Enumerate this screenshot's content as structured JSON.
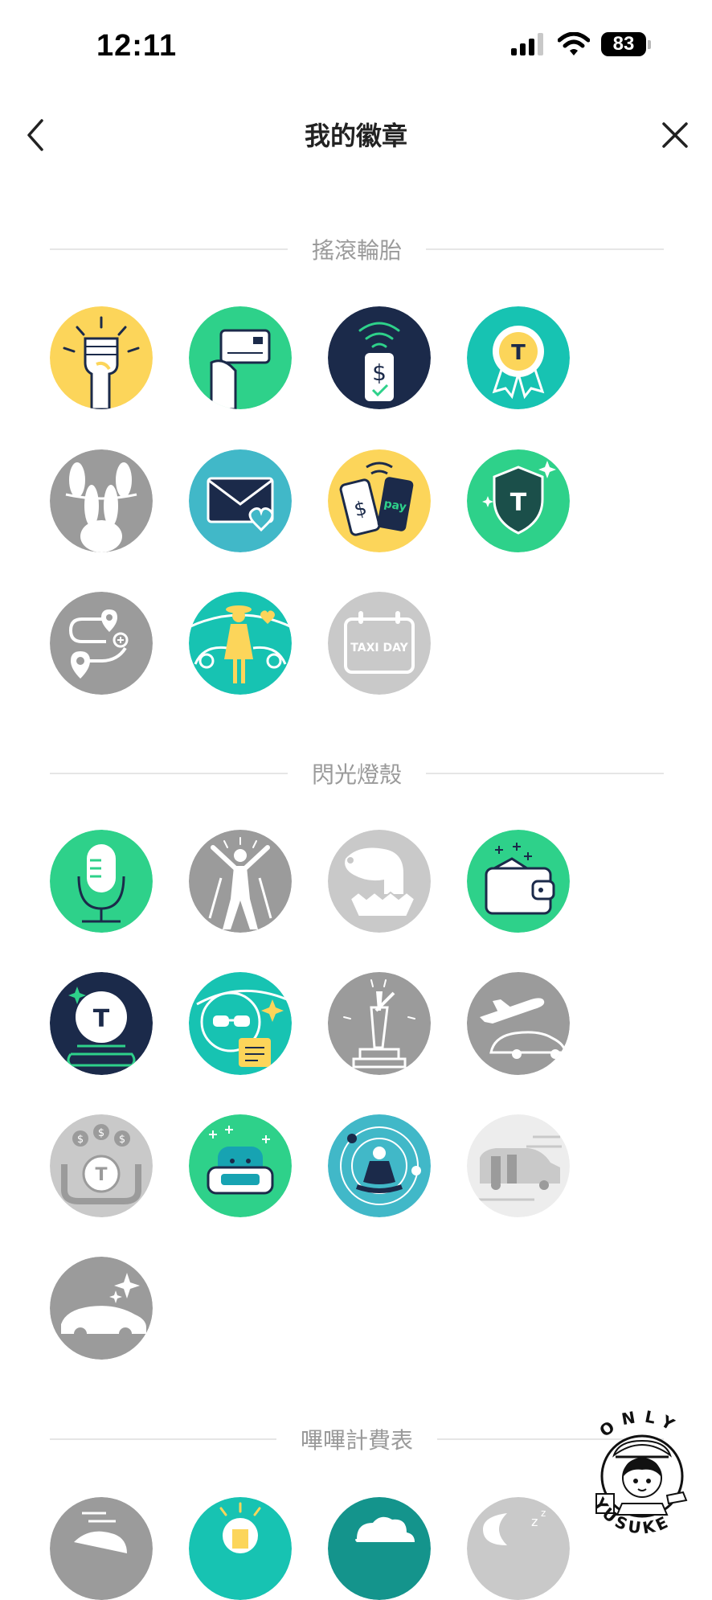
{
  "status_bar": {
    "time": "12:11",
    "battery": "83"
  },
  "header": {
    "title": "我的徽章"
  },
  "sections": [
    {
      "title": "搖滾輪胎"
    },
    {
      "title": "閃光燈殼"
    },
    {
      "title": "嗶嗶計費表"
    }
  ],
  "badges": {
    "taxi_day_text": "TAXI DAY",
    "pay_text": "pay"
  },
  "watermark": {
    "top_text": "ONLY",
    "bottom_text": "YUSUKE"
  },
  "colors": {
    "green": "#2ED18A",
    "yellow": "#FCD55A",
    "navy": "#1B2A4A",
    "teal": "#17C3B2",
    "blue": "#41B8C8",
    "gray": "#9B9B9B",
    "light_gray": "#C9C9C9"
  }
}
